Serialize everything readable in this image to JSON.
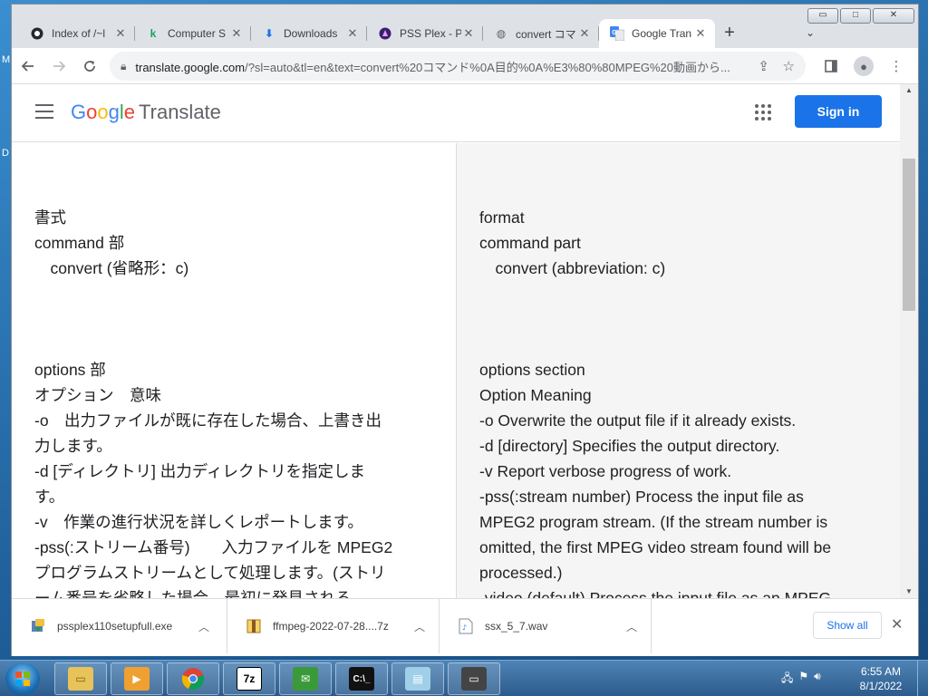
{
  "desktop": {
    "edge_letters": [
      "M",
      "D"
    ]
  },
  "window": {
    "controls": {
      "minimize": "▭",
      "maximize": "□",
      "close": "✕"
    }
  },
  "tabs": [
    {
      "title": "Index of /~l",
      "icon": "github-icon"
    },
    {
      "title": "Computer S",
      "icon": "k-logo-icon"
    },
    {
      "title": "Downloads",
      "icon": "download-icon"
    },
    {
      "title": "PSS Plex - P",
      "icon": "plex-icon"
    },
    {
      "title": "convert コマ",
      "icon": "globe-icon"
    },
    {
      "title": "Google Tran",
      "icon": "google-translate-icon",
      "active": true
    }
  ],
  "toolbar": {
    "url_host": "translate.google.com",
    "url_rest": "/?sl=auto&tl=en&text=convert%20コマンド%0A目的%0A%E3%80%80MPEG%20動画から..."
  },
  "header": {
    "logo_google": [
      "G",
      "o",
      "o",
      "g",
      "l",
      "e"
    ],
    "logo_translate": "Translate",
    "sign_in": "Sign in"
  },
  "source": {
    "group1": [
      "書式",
      "command 部",
      "　convert (省略形：c)"
    ],
    "group2": [
      "options 部",
      "オプション　意味",
      "-o　出力ファイルが既に存在した場合、上書き出",
      "力します。",
      "-d [ディレクトリ] 出力ディレクトリを指定しま",
      "す。",
      "-v　作業の進行状況を詳しくレポートします。",
      "-pss(:ストリーム番号)　　入力ファイルを MPEG2",
      "プログラムストリームとして処理します。(ストリ",
      "ーム番号を省略した場合、最初に発見される"
    ]
  },
  "translation": {
    "group1": [
      "format",
      "command part",
      "　convert (abbreviation: c)"
    ],
    "group2": [
      "options section",
      "Option Meaning",
      "-o Overwrite the output file if it already exists.",
      "-d [directory] Specifies the output directory.",
      "-v Report verbose progress of work.",
      "-pss(:stream number) Process the input file as",
      "MPEG2 program stream. (If the stream number is",
      "omitted, the first MPEG video stream found will be",
      "processed.)",
      "-video (default) Process the input file as an MPEG"
    ]
  },
  "downloads": {
    "items": [
      {
        "name": "pssplex110setupfull.exe",
        "icon": "installer-icon"
      },
      {
        "name": "ffmpeg-2022-07-28....7z",
        "icon": "archive-icon"
      },
      {
        "name": "ssx_5_7.wav",
        "icon": "audio-file-icon"
      }
    ],
    "show_all": "Show all"
  },
  "taskbar": {
    "clock_time": "6:55 AM",
    "clock_date": "8/1/2022"
  }
}
